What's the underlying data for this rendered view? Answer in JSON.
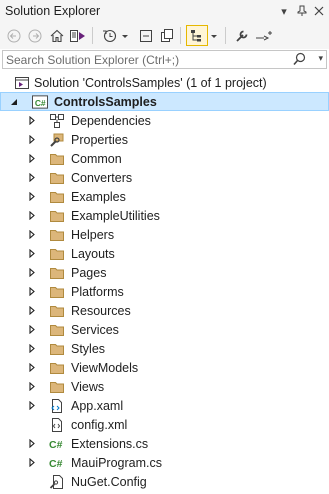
{
  "window": {
    "title": "Solution Explorer"
  },
  "search": {
    "placeholder": "Search Solution Explorer (Ctrl+;)"
  },
  "solution": {
    "label": "Solution 'ControlsSamples' (1 of 1 project)"
  },
  "project": {
    "label": "ControlsSamples"
  },
  "items": [
    {
      "label": "Dependencies",
      "icon": "dependencies-icon",
      "expandable": true
    },
    {
      "label": "Properties",
      "icon": "properties-wrench-icon",
      "expandable": true
    },
    {
      "label": "Common",
      "icon": "folder-icon",
      "expandable": true
    },
    {
      "label": "Converters",
      "icon": "folder-icon",
      "expandable": true
    },
    {
      "label": "Examples",
      "icon": "folder-icon",
      "expandable": true
    },
    {
      "label": "ExampleUtilities",
      "icon": "folder-icon",
      "expandable": true
    },
    {
      "label": "Helpers",
      "icon": "folder-icon",
      "expandable": true
    },
    {
      "label": "Layouts",
      "icon": "folder-icon",
      "expandable": true
    },
    {
      "label": "Pages",
      "icon": "folder-icon",
      "expandable": true
    },
    {
      "label": "Platforms",
      "icon": "folder-icon",
      "expandable": true
    },
    {
      "label": "Resources",
      "icon": "folder-icon",
      "expandable": true
    },
    {
      "label": "Services",
      "icon": "folder-icon",
      "expandable": true
    },
    {
      "label": "Styles",
      "icon": "folder-icon",
      "expandable": true
    },
    {
      "label": "ViewModels",
      "icon": "folder-icon",
      "expandable": true
    },
    {
      "label": "Views",
      "icon": "folder-icon",
      "expandable": true
    },
    {
      "label": "App.xaml",
      "icon": "xaml-file-icon",
      "expandable": true
    },
    {
      "label": "config.xml",
      "icon": "xml-file-icon",
      "expandable": false
    },
    {
      "label": "Extensions.cs",
      "icon": "csharp-file-icon",
      "expandable": true
    },
    {
      "label": "MauiProgram.cs",
      "icon": "csharp-file-icon",
      "expandable": true
    },
    {
      "label": "NuGet.Config",
      "icon": "config-file-icon",
      "expandable": false
    }
  ],
  "colors": {
    "accent": "#007acc",
    "folder": "#dcb67a",
    "selection": "#cce8ff",
    "csharp": "#388a34"
  }
}
